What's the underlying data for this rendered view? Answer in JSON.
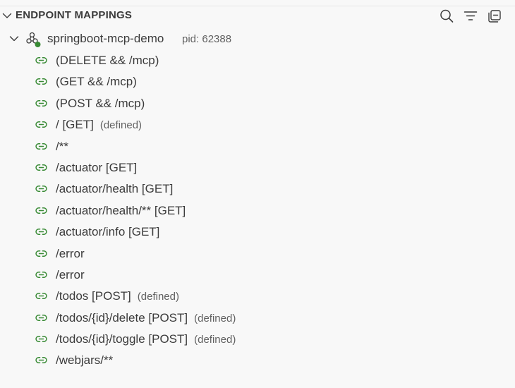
{
  "panel": {
    "title": "ENDPOINT MAPPINGS",
    "toolbar": [
      {
        "name": "search-icon",
        "label": "Search"
      },
      {
        "name": "filter-icon",
        "label": "Filter"
      },
      {
        "name": "collapse-all-icon",
        "label": "Collapse All"
      }
    ]
  },
  "app": {
    "name": "springboot-mcp-demo",
    "pid": "pid: 62388",
    "icon": "spring-app-running-icon",
    "status_color": "#388a34"
  },
  "mappings": [
    {
      "label": "(DELETE && /mcp)",
      "description": ""
    },
    {
      "label": "(GET && /mcp)",
      "description": ""
    },
    {
      "label": "(POST && /mcp)",
      "description": ""
    },
    {
      "label": "/ [GET]",
      "description": "(defined)"
    },
    {
      "label": "/**",
      "description": ""
    },
    {
      "label": "/actuator [GET]",
      "description": ""
    },
    {
      "label": "/actuator/health [GET]",
      "description": ""
    },
    {
      "label": "/actuator/health/** [GET]",
      "description": ""
    },
    {
      "label": "/actuator/info [GET]",
      "description": ""
    },
    {
      "label": "/error",
      "description": ""
    },
    {
      "label": "/error",
      "description": ""
    },
    {
      "label": "/todos [POST]",
      "description": "(defined)"
    },
    {
      "label": "/todos/{id}/delete [POST]",
      "description": "(defined)"
    },
    {
      "label": "/todos/{id}/toggle [POST]",
      "description": "(defined)"
    },
    {
      "label": "/webjars/**",
      "description": ""
    }
  ],
  "colors": {
    "link_icon": "#388a34",
    "text": "#3b3b3b",
    "description": "#616161",
    "background": "#f8f8f8"
  }
}
